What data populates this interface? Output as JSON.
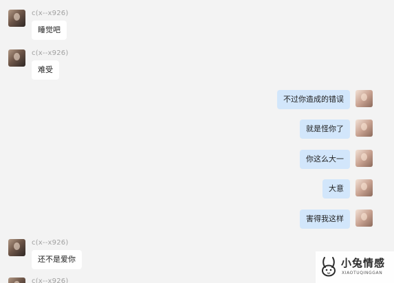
{
  "contact": {
    "name": "c(x--x926)"
  },
  "messages": [
    {
      "text": "睡觉吧"
    },
    {
      "text": "难受"
    },
    {
      "text": "不过你造成的错误"
    },
    {
      "text": "就是怪你了"
    },
    {
      "text": "你这么大一"
    },
    {
      "text": "大意"
    },
    {
      "text": "害得我这样"
    },
    {
      "text": "还不是爱你"
    }
  ],
  "watermark": {
    "title": "小兔情感",
    "subtitle": "XIAOTUQINGGAN"
  },
  "colors": {
    "background": "#f3f3f3",
    "incoming_bubble": "#ffffff",
    "outgoing_bubble": "#d2e6fb",
    "sender_name": "#a0a0a0"
  }
}
